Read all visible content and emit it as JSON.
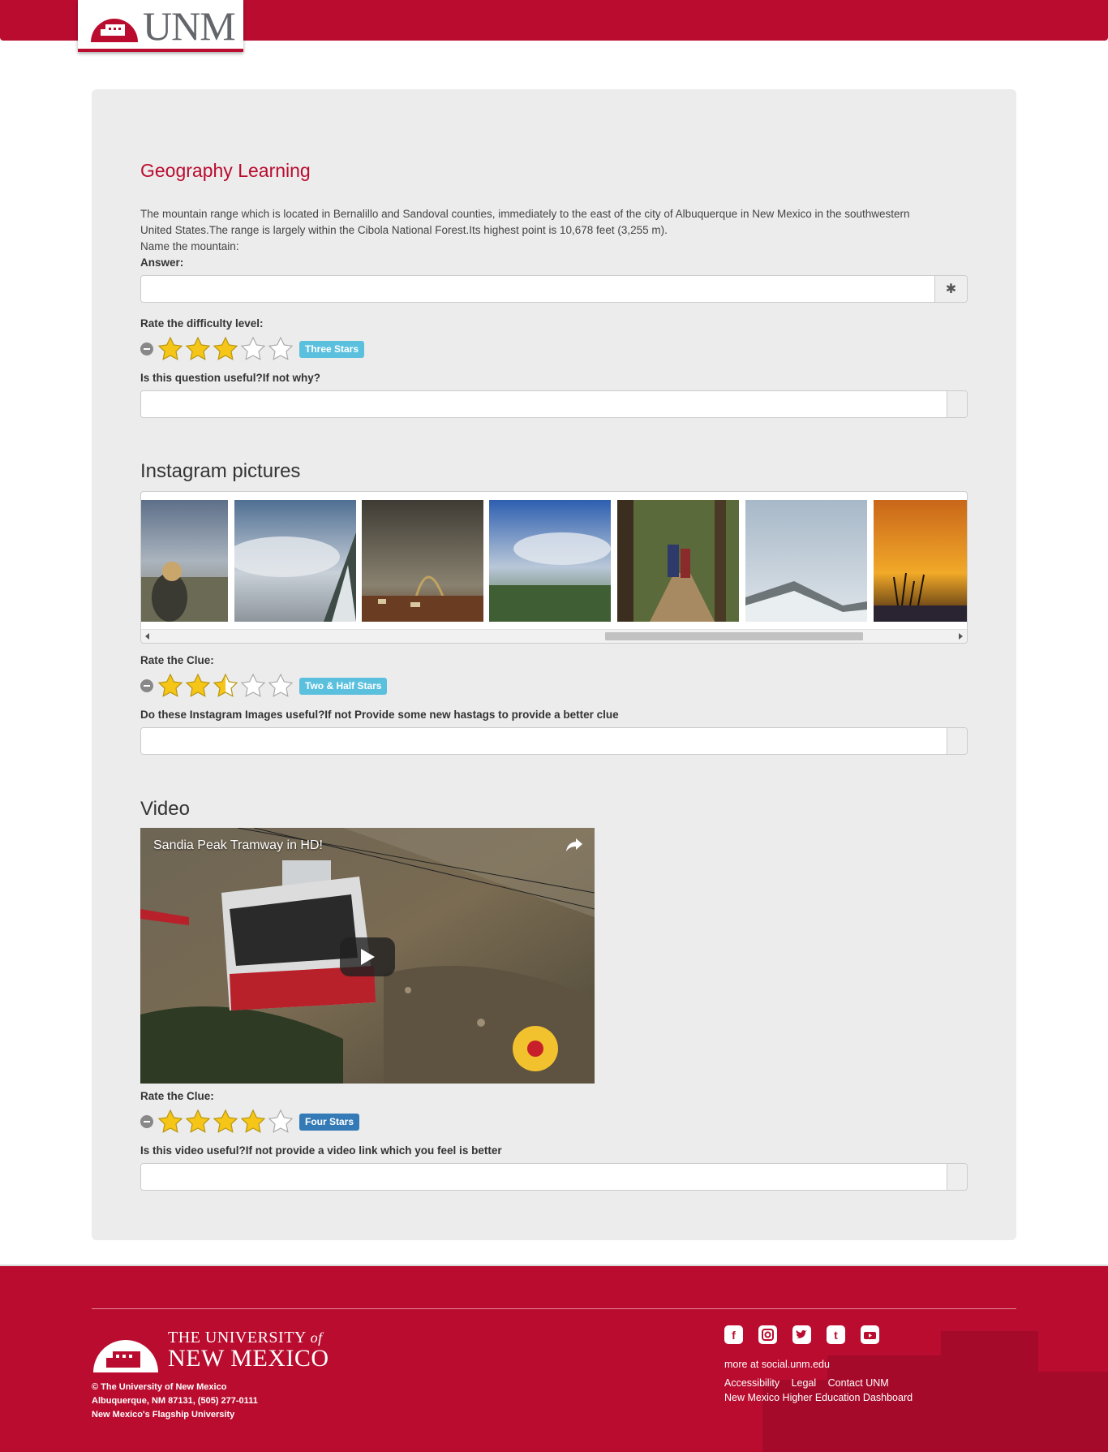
{
  "header": {
    "logo_text": "UNM"
  },
  "question": {
    "title": "Geography Learning",
    "description_line1": "The mountain range which is located in Bernalillo and Sandoval counties, immediately to the east of the city of Albuquerque in New Mexico in the southwestern",
    "description_line2": "United States.The range is largely within the Cibola National Forest.Its highest point is 10,678 feet (3,255 m).",
    "prompt": "Name the mountain:",
    "answer_label": "Answer:",
    "answer_value": "",
    "answer_addon_icon": "asterisk-icon",
    "difficulty_label": "Rate the difficulty level:",
    "difficulty_rating": 3,
    "difficulty_badge": "Three Stars",
    "useful_label": "Is this question useful?If not why?",
    "useful_value": ""
  },
  "instagram": {
    "heading": "Instagram pictures",
    "pictures": [
      {
        "name": "woman-with-binoculars-photo"
      },
      {
        "name": "clouds-over-snowy-trees-photo"
      },
      {
        "name": "rainbow-over-city-photo"
      },
      {
        "name": "green-field-blue-sky-photo"
      },
      {
        "name": "hikers-on-trail-photo"
      },
      {
        "name": "foggy-snowy-ridge-photo"
      },
      {
        "name": "orange-sunset-photo"
      }
    ],
    "scroll_fraction": 0.56,
    "clue_label": "Rate the Clue:",
    "clue_rating": 2.5,
    "clue_badge": "Two & Half Stars",
    "useful_label": "Do these Instagram Images useful?If not Provide some new hastags to provide a better clue",
    "useful_value": ""
  },
  "video": {
    "heading": "Video",
    "title": "Sandia Peak Tramway in HD!",
    "clue_label": "Rate the Clue:",
    "clue_rating": 4,
    "clue_badge": "Four Stars",
    "useful_label": "Is this video useful?If not provide a video link which you feel is better",
    "useful_value": ""
  },
  "footer": {
    "uni_name_top": "THE UNIVERSITY",
    "uni_name_of": "of",
    "uni_name_bottom": "NEW MEXICO",
    "address_line1": "© The University of New Mexico",
    "address_line2": "Albuquerque, NM 87131, (505) 277-0111",
    "address_line3": "New Mexico's Flagship University",
    "social_icons": [
      "facebook-icon",
      "instagram-icon",
      "twitter-icon",
      "tumblr-icon",
      "youtube-icon"
    ],
    "social_more": "more at social.unm.edu",
    "links": [
      "Accessibility",
      "Legal",
      "Contact UNM"
    ],
    "link_dashboard": "New Mexico Higher Education Dashboard",
    "colors": {
      "brand_red": "#ba0c2f",
      "star_gold": "#f5c518",
      "badge_info": "#5bc0de",
      "badge_primary": "#337ab7"
    }
  }
}
